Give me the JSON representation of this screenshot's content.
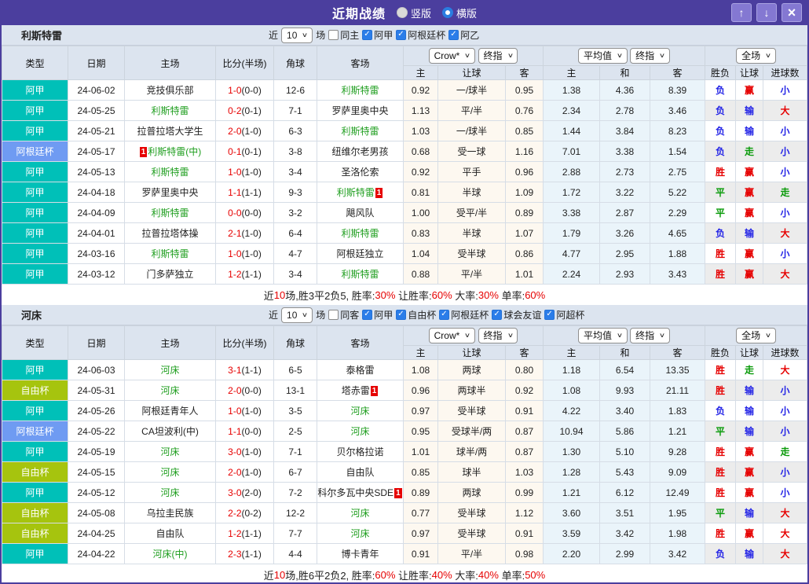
{
  "colors": {
    "accent": "#4b3e9e",
    "accent_button": "#8478d2",
    "header_bg": "#dce4ef",
    "score_red": "#e60000",
    "team_green": "#1f9e1f",
    "crow_bg": "#fdf8f0",
    "avg_bg": "#eaf4fa",
    "stripe": "#ececec",
    "win_red": "#e60000",
    "lose_blue": "#2323e6",
    "draw_green": "#089a08",
    "checkbox_blue": "#2b7de9"
  },
  "league_colors": {
    "阿甲": "#00c0b8",
    "阿根廷杯": "#6f9bf2",
    "自由杯": "#a6c40e"
  },
  "result_color_map": {
    "胜": "win_red",
    "赢": "win_red",
    "大": "win_red",
    "负": "lose_blue",
    "输": "lose_blue",
    "小": "lose_blue",
    "平": "draw_green",
    "走": "draw_green"
  },
  "titlebar": {
    "title": "近期战绩",
    "radios": [
      {
        "label": "竖版",
        "checked": false
      },
      {
        "label": "横版",
        "checked": true
      }
    ],
    "buttons": {
      "up": "↑",
      "down": "↓",
      "close": "×"
    }
  },
  "table": {
    "columns": [
      "类型",
      "日期",
      "主场",
      "比分(半场)",
      "角球",
      "客场"
    ],
    "odds_group": {
      "select1": "Crow*",
      "select2": "终指",
      "cols": [
        "主",
        "让球",
        "客"
      ]
    },
    "avg_group": {
      "select1": "平均值",
      "select2": "终指",
      "cols": [
        "主",
        "和",
        "客"
      ]
    },
    "result_group": {
      "select": "全场",
      "cols": [
        "胜负",
        "让球",
        "进球数"
      ]
    }
  },
  "sections": [
    {
      "team": "利斯特雷",
      "filter": {
        "prefix": "近",
        "count": "10",
        "suffix": "场",
        "same_label": "同主",
        "same_checked": false,
        "leagues": [
          {
            "label": "阿甲",
            "checked": true
          },
          {
            "label": "阿根廷杯",
            "checked": true
          },
          {
            "label": "阿乙",
            "checked": true
          }
        ]
      },
      "rows": [
        {
          "lg": "阿甲",
          "date": "24-06-02",
          "h": "竞技俱乐部",
          "hg": false,
          "s": "1-0",
          "hs": "(0-0)",
          "cor": "12-6",
          "a": "利斯特雷",
          "ag": true,
          "o": [
            "0.92",
            "一/球半",
            "0.95",
            "1.38",
            "4.36",
            "8.39"
          ],
          "res": [
            "负",
            "赢",
            "小"
          ]
        },
        {
          "lg": "阿甲",
          "date": "24-05-25",
          "h": "利斯特雷",
          "hg": true,
          "s": "0-2",
          "hs": "(0-1)",
          "cor": "7-1",
          "a": "罗萨里奥中央",
          "ag": false,
          "o": [
            "1.13",
            "平/半",
            "0.76",
            "2.34",
            "2.78",
            "3.46"
          ],
          "res": [
            "负",
            "输",
            "大"
          ]
        },
        {
          "lg": "阿甲",
          "date": "24-05-21",
          "h": "拉普拉塔大学生",
          "hg": false,
          "s": "2-0",
          "hs": "(1-0)",
          "cor": "6-3",
          "a": "利斯特雷",
          "ag": true,
          "o": [
            "1.03",
            "一/球半",
            "0.85",
            "1.44",
            "3.84",
            "8.23"
          ],
          "res": [
            "负",
            "输",
            "小"
          ]
        },
        {
          "lg": "阿根廷杯",
          "date": "24-05-17",
          "h": "利斯特雷(中)",
          "hg": true,
          "hbb": "1",
          "s": "0-1",
          "hs": "(0-1)",
          "cor": "3-8",
          "a": "纽维尔老男孩",
          "ag": false,
          "o": [
            "0.68",
            "受一球",
            "1.16",
            "7.01",
            "3.38",
            "1.54"
          ],
          "res": [
            "负",
            "走",
            "小"
          ]
        },
        {
          "lg": "阿甲",
          "date": "24-05-13",
          "h": "利斯特雷",
          "hg": true,
          "s": "1-0",
          "hs": "(1-0)",
          "cor": "3-4",
          "a": "圣洛伦索",
          "ag": false,
          "o": [
            "0.92",
            "平手",
            "0.96",
            "2.88",
            "2.73",
            "2.75"
          ],
          "res": [
            "胜",
            "赢",
            "小"
          ]
        },
        {
          "lg": "阿甲",
          "date": "24-04-18",
          "h": "罗萨里奥中央",
          "hg": false,
          "s": "1-1",
          "hs": "(1-1)",
          "cor": "9-3",
          "a": "利斯特雷",
          "ag": true,
          "aba": "1",
          "o": [
            "0.81",
            "半球",
            "1.09",
            "1.72",
            "3.22",
            "5.22"
          ],
          "res": [
            "平",
            "赢",
            "走"
          ]
        },
        {
          "lg": "阿甲",
          "date": "24-04-09",
          "h": "利斯特雷",
          "hg": true,
          "s": "0-0",
          "hs": "(0-0)",
          "cor": "3-2",
          "a": "飓风队",
          "ag": false,
          "o": [
            "1.00",
            "受平/半",
            "0.89",
            "3.38",
            "2.87",
            "2.29"
          ],
          "res": [
            "平",
            "赢",
            "小"
          ]
        },
        {
          "lg": "阿甲",
          "date": "24-04-01",
          "h": "拉普拉塔体操",
          "hg": false,
          "s": "2-1",
          "hs": "(1-0)",
          "cor": "6-4",
          "a": "利斯特雷",
          "ag": true,
          "o": [
            "0.83",
            "半球",
            "1.07",
            "1.79",
            "3.26",
            "4.65"
          ],
          "res": [
            "负",
            "输",
            "大"
          ]
        },
        {
          "lg": "阿甲",
          "date": "24-03-16",
          "h": "利斯特雷",
          "hg": true,
          "s": "1-0",
          "hs": "(1-0)",
          "cor": "4-7",
          "a": "阿根廷独立",
          "ag": false,
          "o": [
            "1.04",
            "受半球",
            "0.86",
            "4.77",
            "2.95",
            "1.88"
          ],
          "res": [
            "胜",
            "赢",
            "小"
          ]
        },
        {
          "lg": "阿甲",
          "date": "24-03-12",
          "h": "门多萨独立",
          "hg": false,
          "s": "1-2",
          "hs": "(1-1)",
          "cor": "3-4",
          "a": "利斯特雷",
          "ag": true,
          "o": [
            "0.88",
            "平/半",
            "1.01",
            "2.24",
            "2.93",
            "3.43"
          ],
          "res": [
            "胜",
            "赢",
            "大"
          ]
        }
      ],
      "summary_parts": [
        [
          "近",
          "k"
        ],
        [
          "10",
          "r"
        ],
        [
          "场,胜3平2负5, 胜率:",
          "k"
        ],
        [
          "30%",
          "r"
        ],
        [
          " 让胜率:",
          "k"
        ],
        [
          "60%",
          "r"
        ],
        [
          " 大率:",
          "k"
        ],
        [
          "30%",
          "r"
        ],
        [
          " 单率:",
          "k"
        ],
        [
          "60%",
          "r"
        ]
      ]
    },
    {
      "team": "河床",
      "filter": {
        "prefix": "近",
        "count": "10",
        "suffix": "场",
        "same_label": "同客",
        "same_checked": false,
        "leagues": [
          {
            "label": "阿甲",
            "checked": true
          },
          {
            "label": "自由杯",
            "checked": true
          },
          {
            "label": "阿根廷杯",
            "checked": true
          },
          {
            "label": "球会友谊",
            "checked": true
          },
          {
            "label": "阿超杯",
            "checked": true
          }
        ]
      },
      "rows": [
        {
          "lg": "阿甲",
          "date": "24-06-03",
          "h": "河床",
          "hg": true,
          "s": "3-1",
          "hs": "(1-1)",
          "cor": "6-5",
          "a": "泰格雷",
          "ag": false,
          "o": [
            "1.08",
            "两球",
            "0.80",
            "1.18",
            "6.54",
            "13.35"
          ],
          "res": [
            "胜",
            "走",
            "大"
          ]
        },
        {
          "lg": "自由杯",
          "date": "24-05-31",
          "h": "河床",
          "hg": true,
          "s": "2-0",
          "hs": "(0-0)",
          "cor": "13-1",
          "a": "塔赤雷",
          "ag": false,
          "aba": "1",
          "o": [
            "0.96",
            "两球半",
            "0.92",
            "1.08",
            "9.93",
            "21.11"
          ],
          "res": [
            "胜",
            "输",
            "小"
          ]
        },
        {
          "lg": "阿甲",
          "date": "24-05-26",
          "h": "阿根廷青年人",
          "hg": false,
          "s": "1-0",
          "hs": "(1-0)",
          "cor": "3-5",
          "a": "河床",
          "ag": true,
          "o": [
            "0.97",
            "受半球",
            "0.91",
            "4.22",
            "3.40",
            "1.83"
          ],
          "res": [
            "负",
            "输",
            "小"
          ]
        },
        {
          "lg": "阿根廷杯",
          "date": "24-05-22",
          "h": "CA坦波利(中)",
          "hg": false,
          "s": "1-1",
          "hs": "(0-0)",
          "cor": "2-5",
          "a": "河床",
          "ag": true,
          "o": [
            "0.95",
            "受球半/两",
            "0.87",
            "10.94",
            "5.86",
            "1.21"
          ],
          "res": [
            "平",
            "输",
            "小"
          ]
        },
        {
          "lg": "阿甲",
          "date": "24-05-19",
          "h": "河床",
          "hg": true,
          "s": "3-0",
          "hs": "(1-0)",
          "cor": "7-1",
          "a": "贝尔格拉诺",
          "ag": false,
          "o": [
            "1.01",
            "球半/两",
            "0.87",
            "1.30",
            "5.10",
            "9.28"
          ],
          "res": [
            "胜",
            "赢",
            "走"
          ]
        },
        {
          "lg": "自由杯",
          "date": "24-05-15",
          "h": "河床",
          "hg": true,
          "s": "2-0",
          "hs": "(1-0)",
          "cor": "6-7",
          "a": "自由队",
          "ag": false,
          "o": [
            "0.85",
            "球半",
            "1.03",
            "1.28",
            "5.43",
            "9.09"
          ],
          "res": [
            "胜",
            "赢",
            "小"
          ]
        },
        {
          "lg": "阿甲",
          "date": "24-05-12",
          "h": "河床",
          "hg": true,
          "s": "3-0",
          "hs": "(2-0)",
          "cor": "7-2",
          "a": "科尔多瓦中央SDE",
          "ag": false,
          "aba": "1",
          "o": [
            "0.89",
            "两球",
            "0.99",
            "1.21",
            "6.12",
            "12.49"
          ],
          "res": [
            "胜",
            "赢",
            "小"
          ]
        },
        {
          "lg": "自由杯",
          "date": "24-05-08",
          "h": "乌拉圭民族",
          "hg": false,
          "s": "2-2",
          "hs": "(0-2)",
          "cor": "12-2",
          "a": "河床",
          "ag": true,
          "o": [
            "0.77",
            "受半球",
            "1.12",
            "3.60",
            "3.51",
            "1.95"
          ],
          "res": [
            "平",
            "输",
            "大"
          ]
        },
        {
          "lg": "自由杯",
          "date": "24-04-25",
          "h": "自由队",
          "hg": false,
          "s": "1-2",
          "hs": "(1-1)",
          "cor": "7-7",
          "a": "河床",
          "ag": true,
          "o": [
            "0.97",
            "受半球",
            "0.91",
            "3.59",
            "3.42",
            "1.98"
          ],
          "res": [
            "胜",
            "赢",
            "大"
          ]
        },
        {
          "lg": "阿甲",
          "date": "24-04-22",
          "h": "河床(中)",
          "hg": true,
          "s": "2-3",
          "hs": "(1-1)",
          "cor": "4-4",
          "a": "博卡青年",
          "ag": false,
          "o": [
            "0.91",
            "平/半",
            "0.98",
            "2.20",
            "2.99",
            "3.42"
          ],
          "res": [
            "负",
            "输",
            "大"
          ]
        }
      ],
      "summary_parts": [
        [
          "近",
          "k"
        ],
        [
          "10",
          "r"
        ],
        [
          "场,胜6平2负2, 胜率:",
          "k"
        ],
        [
          "60%",
          "r"
        ],
        [
          " 让胜率:",
          "k"
        ],
        [
          "40%",
          "r"
        ],
        [
          " 大率:",
          "k"
        ],
        [
          "40%",
          "r"
        ],
        [
          " 单率:",
          "k"
        ],
        [
          "50%",
          "r"
        ]
      ]
    }
  ]
}
